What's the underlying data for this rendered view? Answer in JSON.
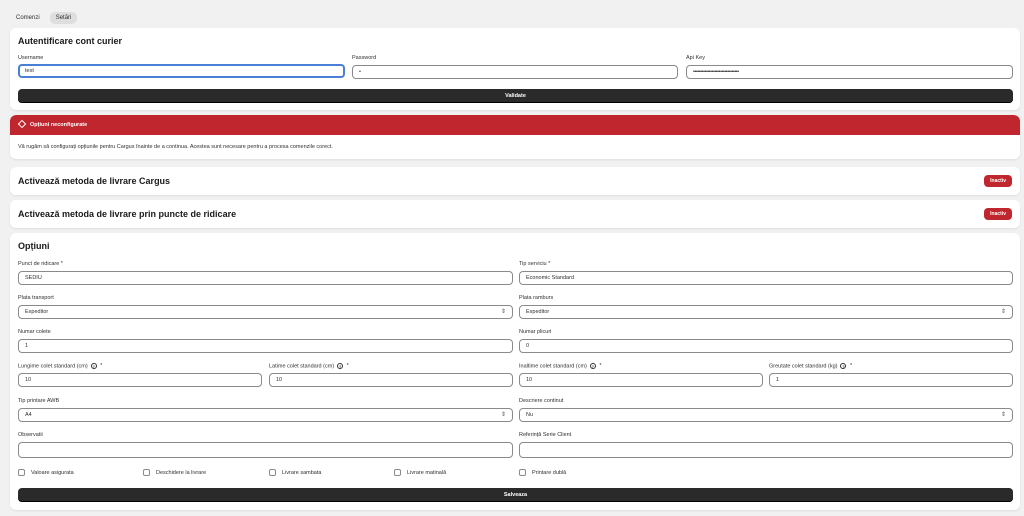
{
  "tabs": [
    {
      "label": "Comenzi"
    },
    {
      "label": "Setări"
    }
  ],
  "auth": {
    "title": "Autentificare cont curier",
    "username_label": "Username",
    "username_value": "test",
    "password_label": "Password",
    "password_value": "•",
    "apikey_label": "Api Key",
    "apikey_value": "••••••••••••••••••••••••••••••••",
    "validate_label": "Validate"
  },
  "banner": {
    "title": "Opțiuni neconfigurate",
    "message": "Vă rugăm să configurați opțiunile pentru Cargus înainte de a continua. Acestea sunt necesare pentru a procesa comenzile corect.",
    "color": "#c0262d"
  },
  "method1": {
    "title": "Activează metoda de livrare Cargus",
    "status": "Inactiv"
  },
  "method2": {
    "title": "Activează metoda de livrare prin puncte de ridicare",
    "status": "Inactiv"
  },
  "options": {
    "title": "Opțiuni",
    "pickup_label": "Punct de ridicare *",
    "pickup_value": "SEDIU",
    "service_label": "Tip serviciu *",
    "service_value": "Economic Standard",
    "transport_label": "Plata transport",
    "transport_value": "Expeditor",
    "ramburs_label": "Plata ramburs",
    "ramburs_value": "Expeditor",
    "colete_label": "Numar colete",
    "colete_value": "1",
    "plicuri_label": "Numar plicuri",
    "plicuri_value": "0",
    "length_label": "Lungime colet standard (cm)",
    "length_value": "10",
    "width_label": "Latime colet standard (cm)",
    "width_value": "10",
    "height_label": "Inaltime colet standard (cm)",
    "height_value": "10",
    "weight_label": "Greutate colet standard (kg)",
    "weight_value": "1",
    "required_mark": "*",
    "awb_label": "Tip printare AWB",
    "awb_value": "A4",
    "content_label": "Descriere continut",
    "content_value": "Nu",
    "observations_label": "Observatii",
    "observations_value": "",
    "reference_label": "Referință Serie Client",
    "reference_value": "",
    "checks": [
      "Valoare asigurata",
      "Deschidere la livrare",
      "Livrare sambata",
      "Livrare matinală",
      "Printare dublă"
    ],
    "save_label": "Salveaza"
  }
}
